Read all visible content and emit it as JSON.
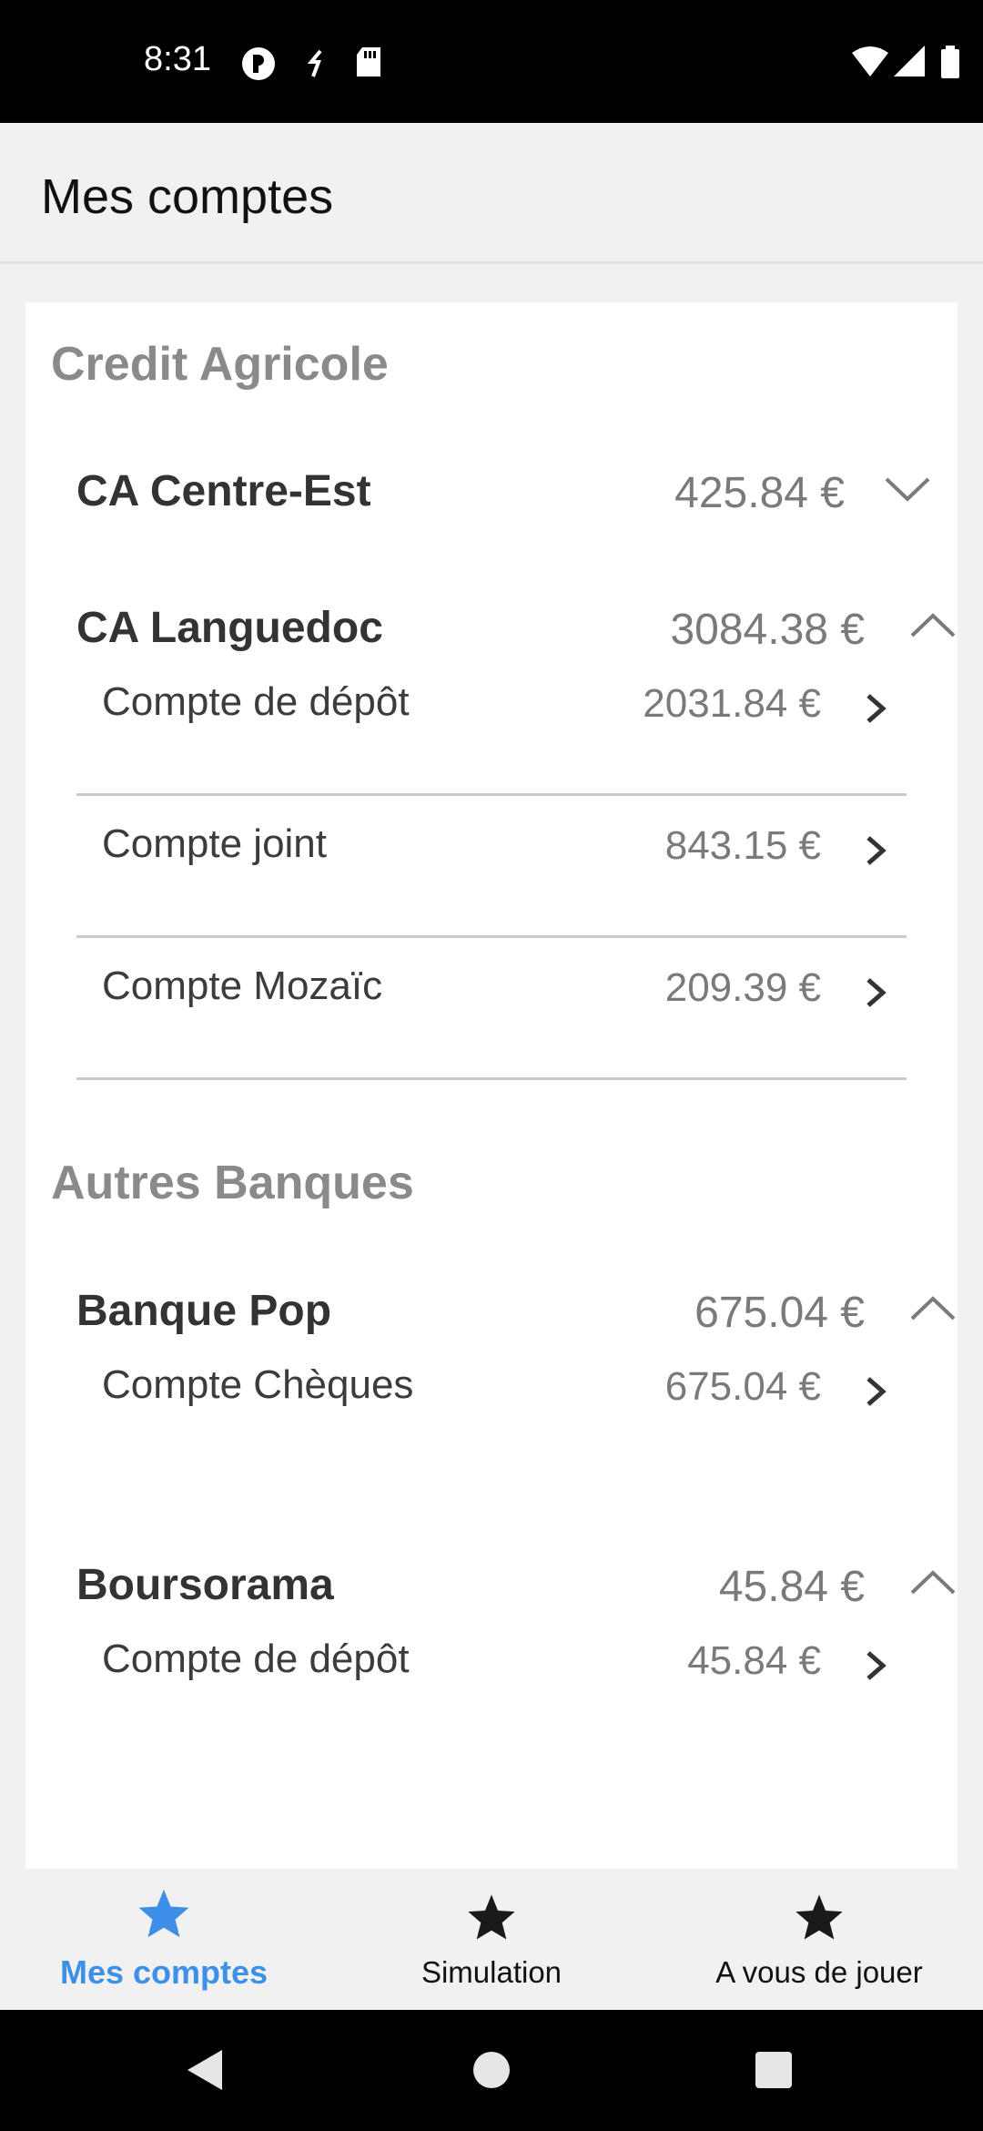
{
  "status_bar": {
    "time": "8:31"
  },
  "app_bar": {
    "title": "Mes comptes"
  },
  "sections": [
    {
      "title": "Credit Agricole",
      "banks": [
        {
          "name": "CA Centre-Est",
          "amount": "425.84 €",
          "expanded": false,
          "accounts": []
        },
        {
          "name": "CA Languedoc",
          "amount": "3084.38 €",
          "expanded": true,
          "accounts": [
            {
              "name": "Compte de dépôt",
              "amount": "2031.84 €"
            },
            {
              "name": "Compte joint",
              "amount": "843.15 €"
            },
            {
              "name": "Compte Mozaïc",
              "amount": "209.39 €"
            }
          ]
        }
      ]
    },
    {
      "title": "Autres Banques",
      "banks": [
        {
          "name": "Banque Pop",
          "amount": "675.04 €",
          "expanded": true,
          "accounts": [
            {
              "name": "Compte Chèques",
              "amount": "675.04 €"
            }
          ]
        },
        {
          "name": "Boursorama",
          "amount": "45.84 €",
          "expanded": true,
          "accounts": [
            {
              "name": "Compte de dépôt",
              "amount": "45.84 €"
            }
          ]
        }
      ]
    }
  ],
  "bottom_nav": {
    "items": [
      {
        "label": "Mes comptes",
        "icon": "star-icon",
        "active": true
      },
      {
        "label": "Simulation",
        "icon": "star-icon",
        "active": false
      },
      {
        "label": "A vous de jouer",
        "icon": "star-icon",
        "active": false
      }
    ]
  },
  "colors": {
    "accent": "#3d8fe8",
    "section_title": "#8a8a8a",
    "amount": "#7a7a7a"
  }
}
